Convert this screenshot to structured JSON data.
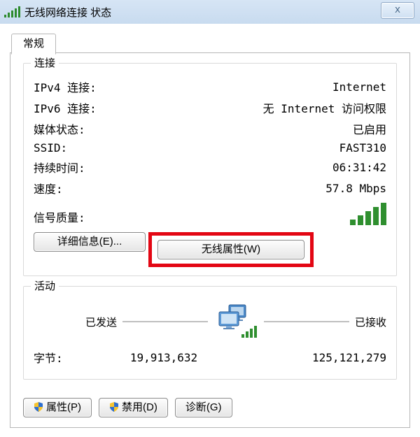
{
  "window": {
    "title": "无线网络连接 状态",
    "close": "x"
  },
  "tab": {
    "general": "常规"
  },
  "connection": {
    "legend": "连接",
    "rows": {
      "ipv4_label": "IPv4 连接:",
      "ipv4_value": "Internet",
      "ipv6_label": "IPv6 连接:",
      "ipv6_value": "无 Internet 访问权限",
      "media_label": "媒体状态:",
      "media_value": "已启用",
      "ssid_label": "SSID:",
      "ssid_value": "FAST310",
      "duration_label": "持续时间:",
      "duration_value": "06:31:42",
      "speed_label": "速度:",
      "speed_value": "57.8 Mbps",
      "signal_label": "信号质量:"
    },
    "buttons": {
      "details": "详细信息(E)...",
      "wireless_props": "无线属性(W)"
    }
  },
  "activity": {
    "legend": "活动",
    "sent": "已发送",
    "received": "已接收",
    "bytes_label": "字节:",
    "bytes_sent": "19,913,632",
    "bytes_received": "125,121,279"
  },
  "bottom": {
    "properties": "属性(P)",
    "disable": "禁用(D)",
    "diagnose": "诊断(G)"
  }
}
